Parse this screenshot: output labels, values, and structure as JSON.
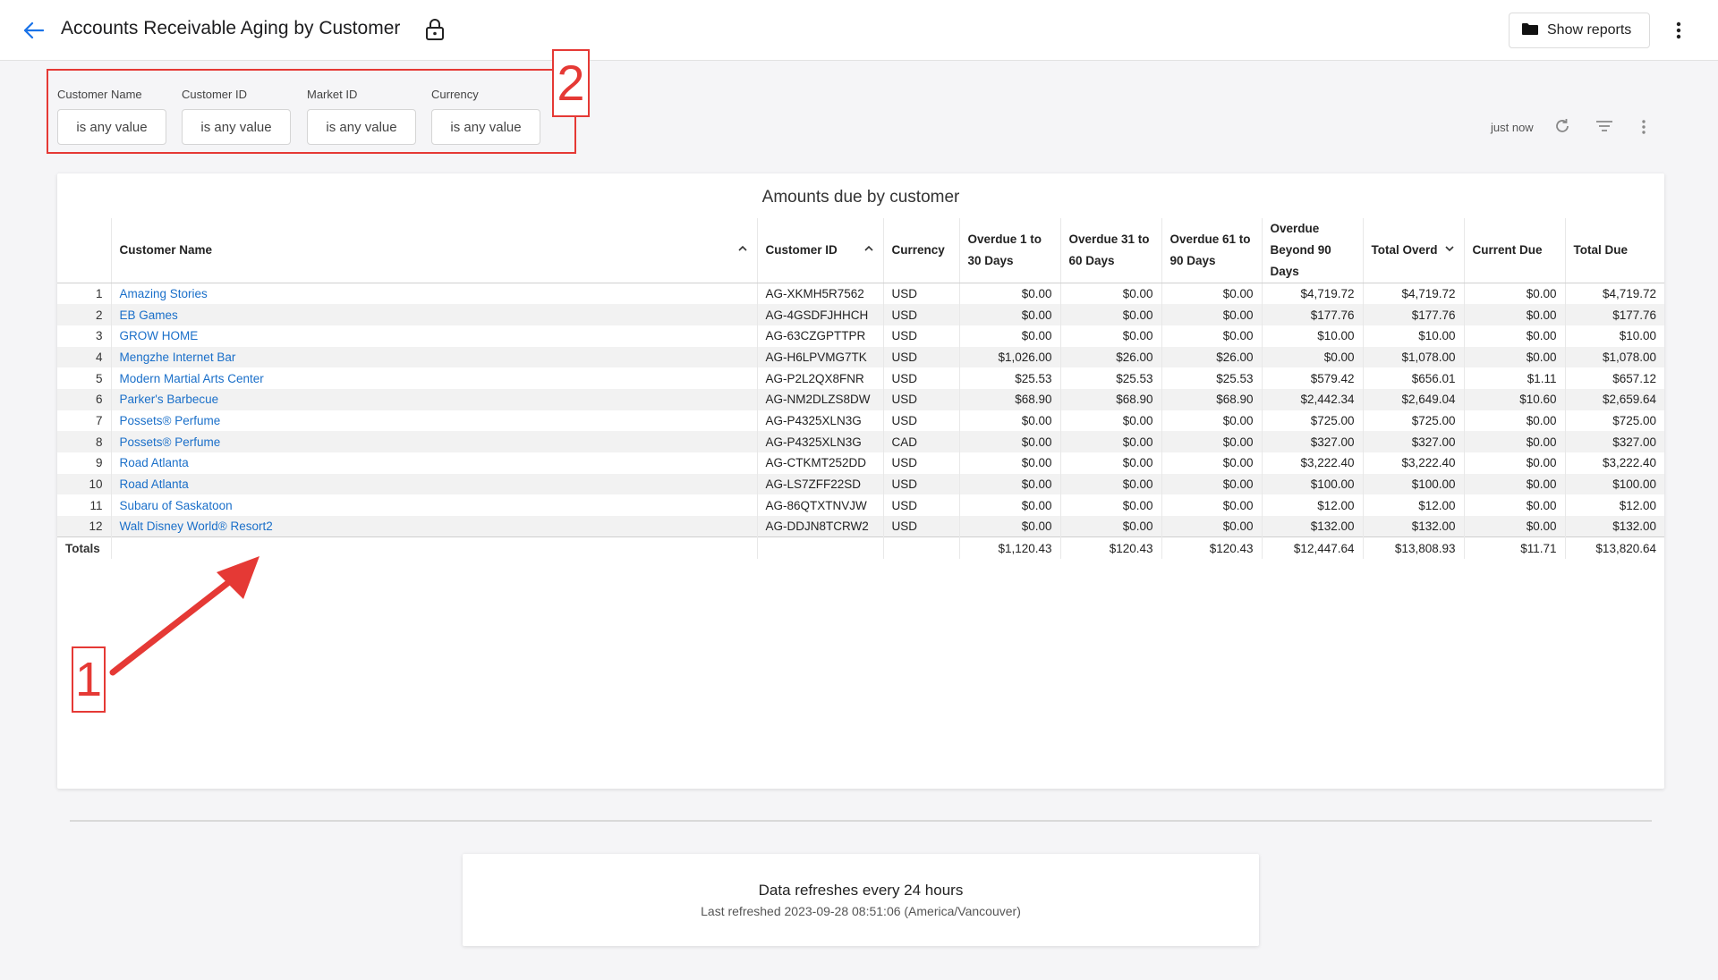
{
  "header": {
    "title": "Accounts Receivable Aging by Customer",
    "show_reports_label": "Show reports"
  },
  "filters": [
    {
      "label": "Customer Name",
      "value": "is any value"
    },
    {
      "label": "Customer ID",
      "value": "is any value"
    },
    {
      "label": "Market ID",
      "value": "is any value"
    },
    {
      "label": "Currency",
      "value": "is any value"
    }
  ],
  "toolbar": {
    "refresh_status": "just now"
  },
  "annotations": {
    "label_1": "1",
    "label_2": "2"
  },
  "table": {
    "title": "Amounts due by customer",
    "columns": [
      "",
      "Customer Name",
      "Customer ID",
      "Currency",
      "Overdue 1 to 30 Days",
      "Overdue 31 to 60 Days",
      "Overdue 61 to 90 Days",
      "Overdue Beyond 90 Days",
      "Total Overd",
      "Current Due",
      "Total Due"
    ],
    "rows": [
      [
        "1",
        "Amazing Stories",
        "AG-XKMH5R7562",
        "USD",
        "$0.00",
        "$0.00",
        "$0.00",
        "$4,719.72",
        "$4,719.72",
        "$0.00",
        "$4,719.72"
      ],
      [
        "2",
        "EB Games",
        "AG-4GSDFJHHCH",
        "USD",
        "$0.00",
        "$0.00",
        "$0.00",
        "$177.76",
        "$177.76",
        "$0.00",
        "$177.76"
      ],
      [
        "3",
        "GROW HOME",
        "AG-63CZGPTTPR",
        "USD",
        "$0.00",
        "$0.00",
        "$0.00",
        "$10.00",
        "$10.00",
        "$0.00",
        "$10.00"
      ],
      [
        "4",
        "Mengzhe Internet Bar",
        "AG-H6LPVMG7TK",
        "USD",
        "$1,026.00",
        "$26.00",
        "$26.00",
        "$0.00",
        "$1,078.00",
        "$0.00",
        "$1,078.00"
      ],
      [
        "5",
        "Modern Martial Arts Center",
        "AG-P2L2QX8FNR",
        "USD",
        "$25.53",
        "$25.53",
        "$25.53",
        "$579.42",
        "$656.01",
        "$1.11",
        "$657.12"
      ],
      [
        "6",
        "Parker's Barbecue",
        "AG-NM2DLZS8DW",
        "USD",
        "$68.90",
        "$68.90",
        "$68.90",
        "$2,442.34",
        "$2,649.04",
        "$10.60",
        "$2,659.64"
      ],
      [
        "7",
        "Possets® Perfume",
        "AG-P4325XLN3G",
        "USD",
        "$0.00",
        "$0.00",
        "$0.00",
        "$725.00",
        "$725.00",
        "$0.00",
        "$725.00"
      ],
      [
        "8",
        "Possets® Perfume",
        "AG-P4325XLN3G",
        "CAD",
        "$0.00",
        "$0.00",
        "$0.00",
        "$327.00",
        "$327.00",
        "$0.00",
        "$327.00"
      ],
      [
        "9",
        "Road Atlanta",
        "AG-CTKMT252DD",
        "USD",
        "$0.00",
        "$0.00",
        "$0.00",
        "$3,222.40",
        "$3,222.40",
        "$0.00",
        "$3,222.40"
      ],
      [
        "10",
        "Road Atlanta",
        "AG-LS7ZFF22SD",
        "USD",
        "$0.00",
        "$0.00",
        "$0.00",
        "$100.00",
        "$100.00",
        "$0.00",
        "$100.00"
      ],
      [
        "11",
        "Subaru of Saskatoon",
        "AG-86QTXTNVJW",
        "USD",
        "$0.00",
        "$0.00",
        "$0.00",
        "$12.00",
        "$12.00",
        "$0.00",
        "$12.00"
      ],
      [
        "12",
        "Walt Disney World® Resort2",
        "AG-DDJN8TCRW2",
        "USD",
        "$0.00",
        "$0.00",
        "$0.00",
        "$132.00",
        "$132.00",
        "$0.00",
        "$132.00"
      ]
    ],
    "totals": [
      "Totals",
      "",
      "",
      "",
      "$1,120.43",
      "$120.43",
      "$120.43",
      "$12,447.64",
      "$13,808.93",
      "$11.71",
      "$13,820.64"
    ]
  },
  "footer": {
    "title": "Data refreshes every 24 hours",
    "subtitle": "Last refreshed 2023-09-28 08:51:06 (America/Vancouver)"
  },
  "colors": {
    "link": "#1a6fc9",
    "annotation": "#e53935",
    "accent": "#1a73e8"
  }
}
